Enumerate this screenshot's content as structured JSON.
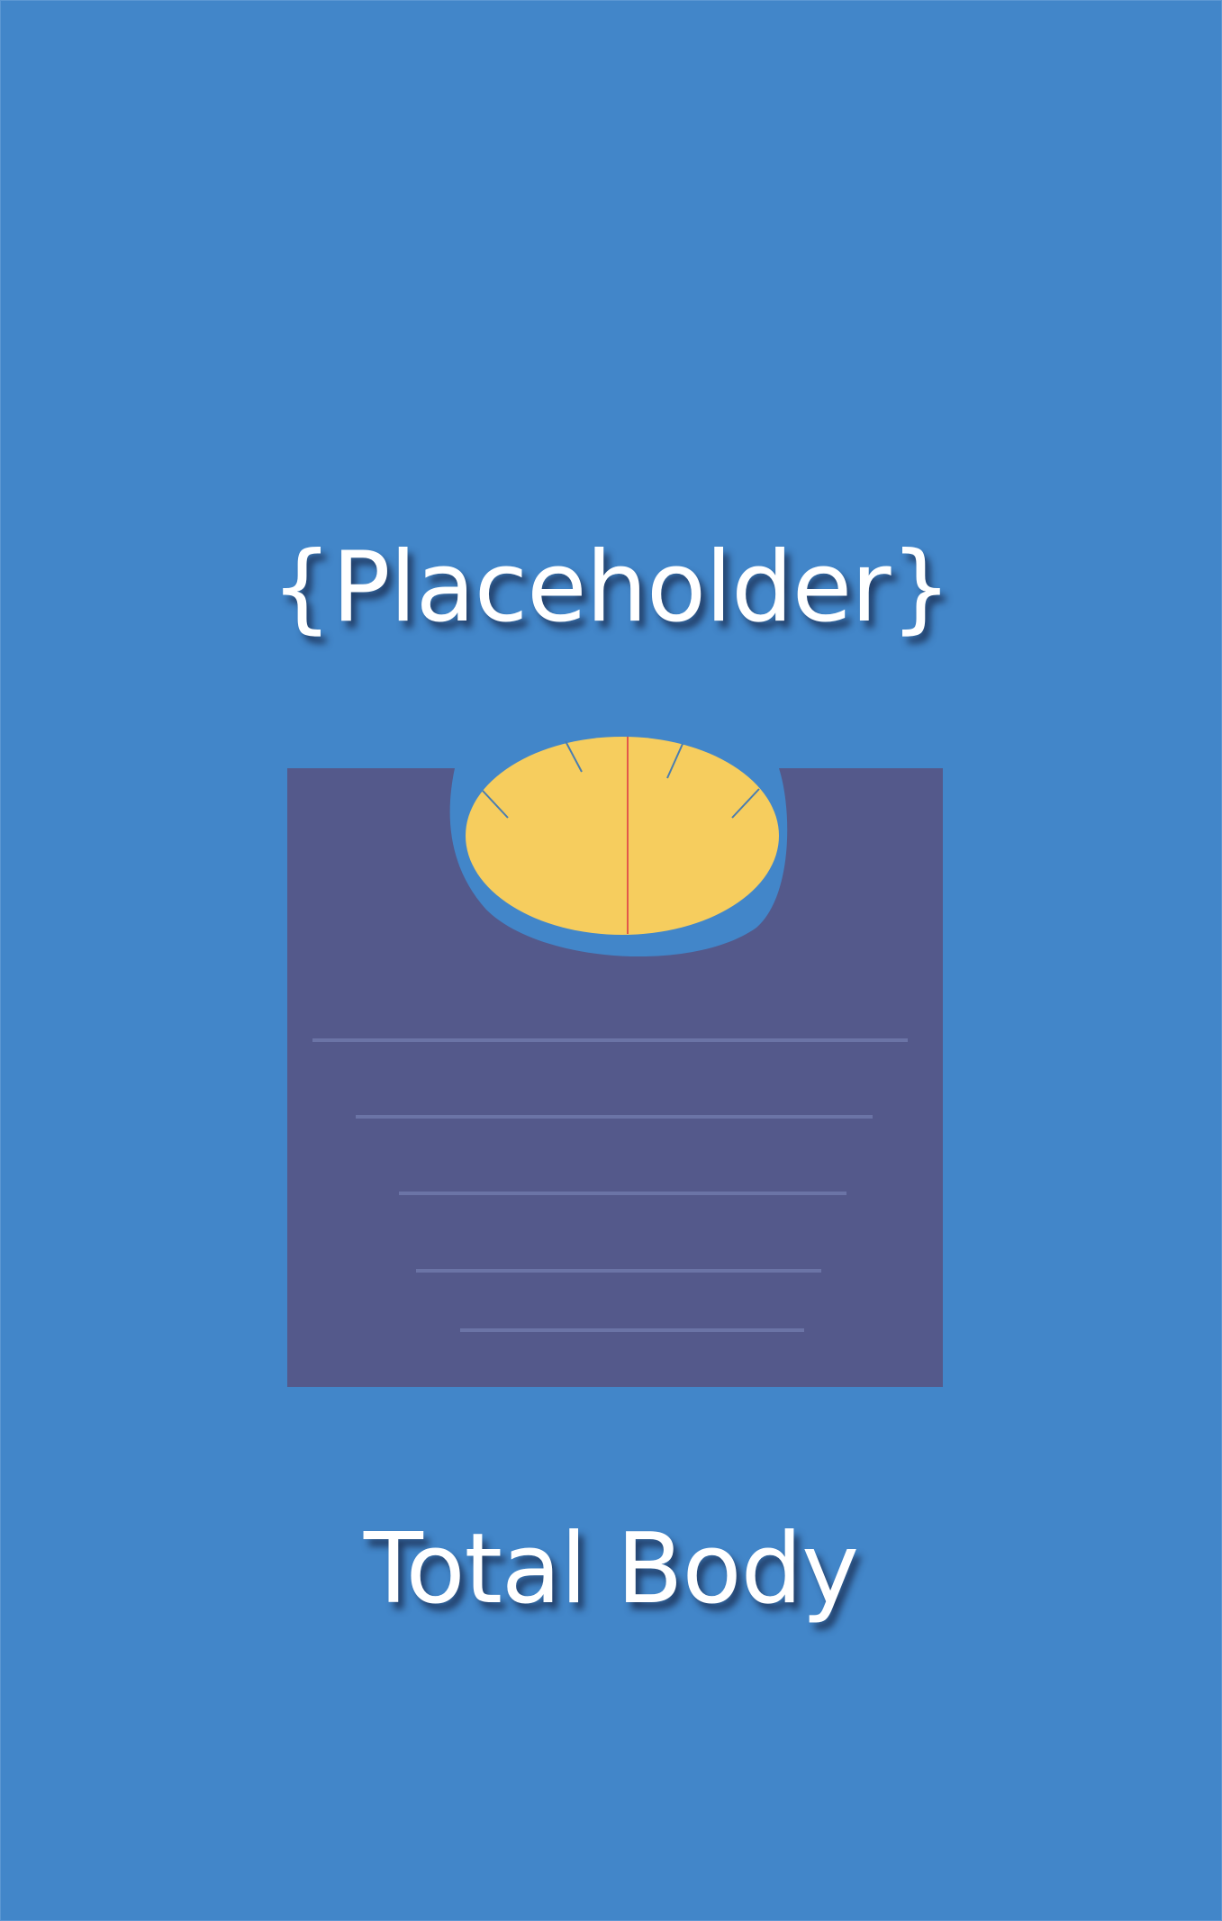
{
  "title": "{Placeholder}",
  "subtitle": "Total Body",
  "illustration": {
    "icon": "bathroom-scale-icon",
    "colors": {
      "background": "#4286c9",
      "scale_body": "#54598b",
      "dial_face": "#f6cd5e",
      "dial_needle": "#e2584a",
      "dial_ticks": "#4a7db0",
      "platform_lines": "#6b74a6"
    }
  }
}
